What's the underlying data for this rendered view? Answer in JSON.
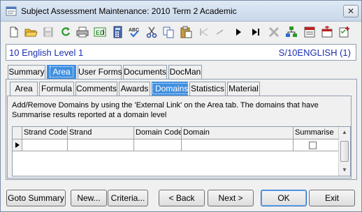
{
  "window": {
    "title": "Subject Assessment Maintenance:  2010 Term 2 Academic",
    "close_glyph": "✕"
  },
  "toolbar": {
    "icons": [
      "new-document-icon",
      "open-folder-icon",
      "save-icon",
      "refresh-icon",
      "print-icon",
      "edit-icon",
      "calculator-icon",
      "spellcheck-icon",
      "cut-icon",
      "copy-icon",
      "paste-icon",
      "first-record-icon",
      "previous-record-icon",
      "next-record-icon",
      "last-record-icon",
      "delete-icon",
      "network-icon",
      "report-icon",
      "report-add-icon",
      "checklist-icon"
    ]
  },
  "info": {
    "subject": "10 English Level 1",
    "code": "S/10ENGLISH (1)"
  },
  "tabs_main": [
    "Summary",
    "Area",
    "User Forms",
    "Documents",
    "DocMan"
  ],
  "tabs_main_active": "Area",
  "tabs_sub": [
    "Area",
    "Formula",
    "Comments",
    "Awards",
    "Domains",
    "Statistics",
    "Material"
  ],
  "tabs_sub_active": "Domains",
  "description": "Add/Remove Domains by using the 'External Link' on the Area tab.  The domains that have Summarise results reported at a domain level",
  "grid": {
    "columns": [
      "Strand Code",
      "Strand",
      "Domain Code",
      "Domain",
      "Summarise"
    ],
    "rows": [
      {
        "strand_code": "",
        "strand": "",
        "domain_code": "",
        "domain": "",
        "summarise": false
      }
    ]
  },
  "buttons": {
    "goto_summary": "Goto Summary",
    "new": "New...",
    "criteria": "Criteria...",
    "back": "< Back",
    "next": "Next >",
    "ok": "OK",
    "exit": "Exit"
  }
}
